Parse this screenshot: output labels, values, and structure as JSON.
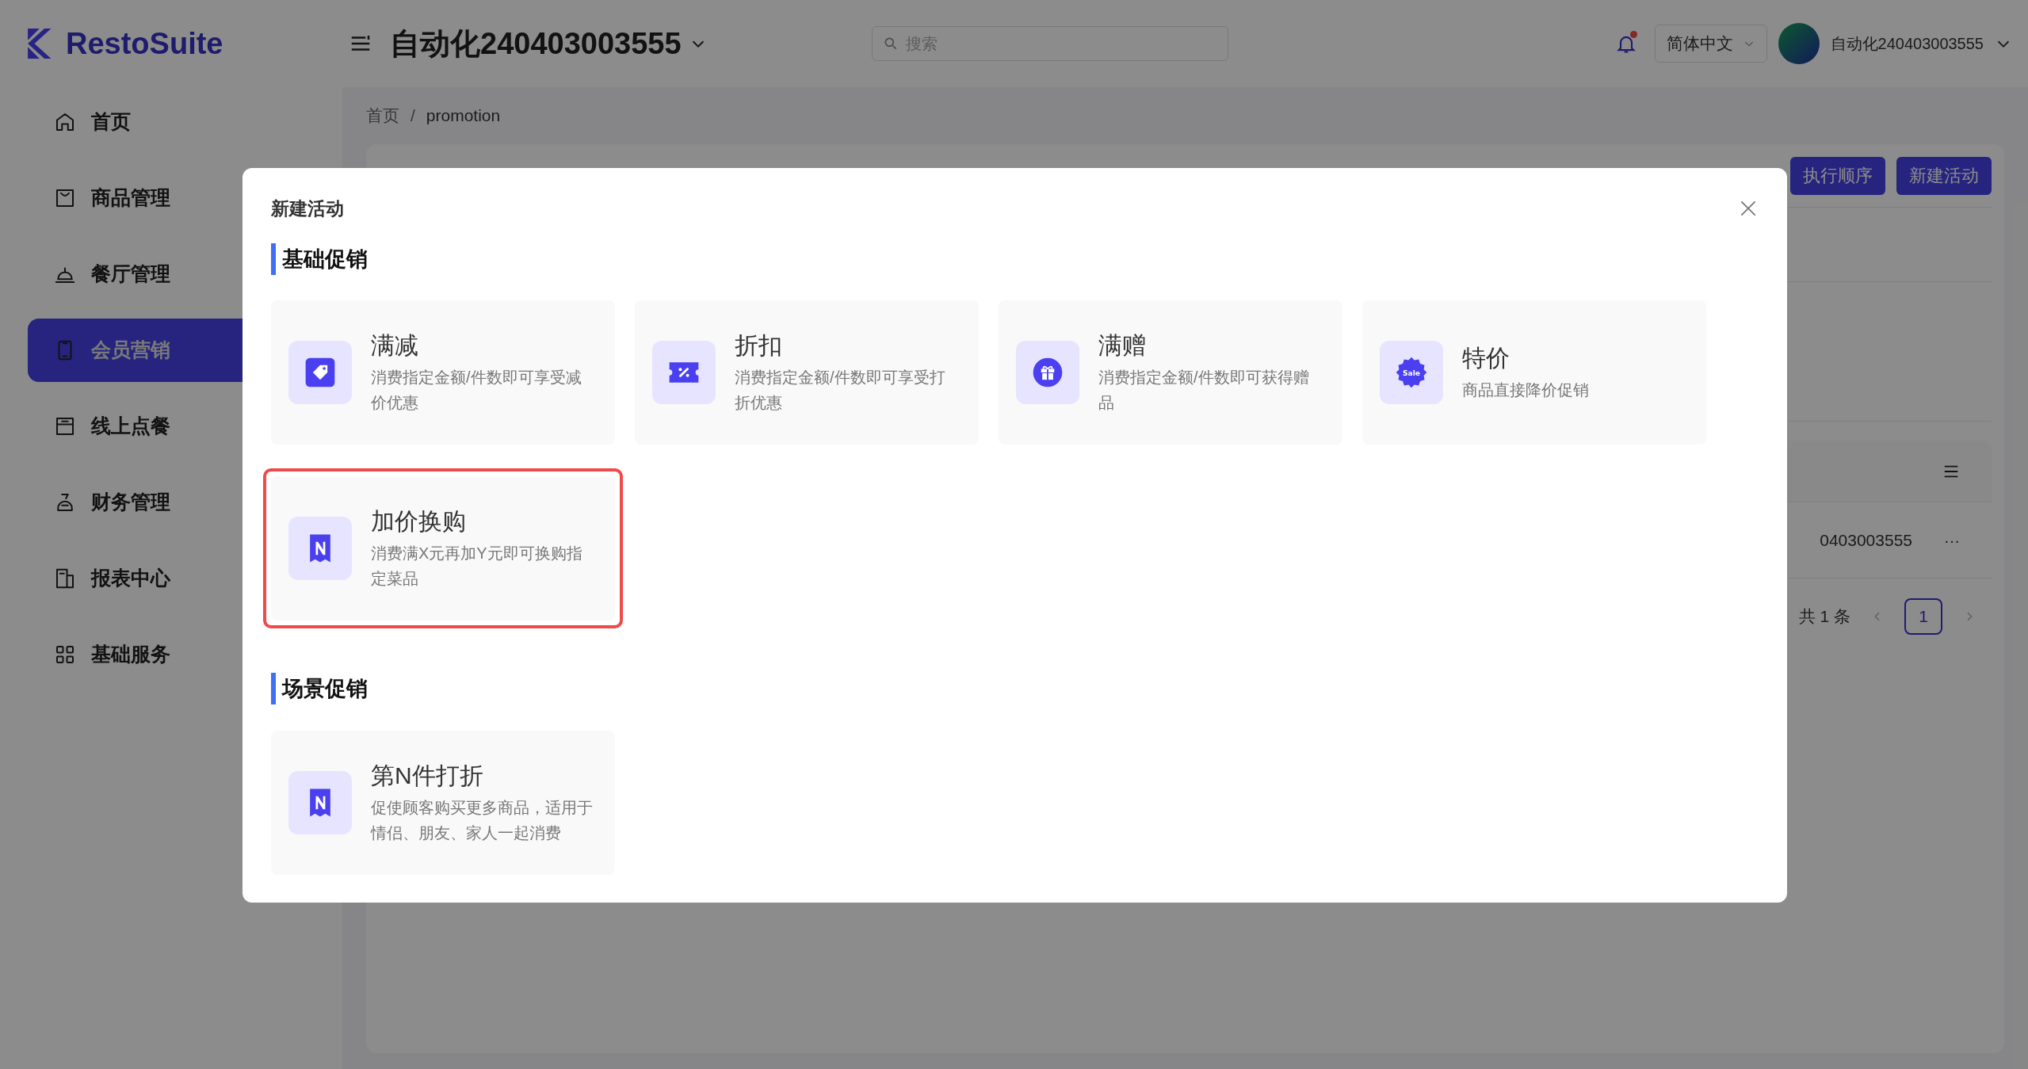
{
  "header": {
    "logo": "RestoSuite",
    "store": "自动化240403003555",
    "search": {
      "placeholder": "搜索"
    },
    "notification": {
      "unread": true
    },
    "language": "简体中文",
    "user": "自动化240403003555"
  },
  "sidebar": {
    "items": [
      {
        "label": "首页",
        "selected": false
      },
      {
        "label": "商品管理",
        "selected": false
      },
      {
        "label": "餐厅管理",
        "selected": false
      },
      {
        "label": "会员营销",
        "selected": true
      },
      {
        "label": "线上点餐",
        "selected": false
      },
      {
        "label": "财务管理",
        "selected": false
      },
      {
        "label": "报表中心",
        "selected": false
      },
      {
        "label": "基础服务",
        "selected": false
      }
    ]
  },
  "breadcrumb": {
    "items": [
      "首页",
      "promotion"
    ],
    "separator": "/"
  },
  "toolbar_buttons": [
    "执行顺序",
    "新建活动"
  ],
  "table": {
    "rows": [
      {
        "column_1": "0403003555",
        "actions": "···"
      }
    ]
  },
  "pagination": {
    "total": "共 1 条",
    "pages": [
      {
        "label": "1",
        "selected": true
      }
    ]
  },
  "modal": {
    "title": "新建活动",
    "sections": [
      {
        "title": "基础促销",
        "cards": [
          {
            "title": "满减",
            "description": "消费指定金额/件数即可享受减价优惠",
            "highlighted": false
          },
          {
            "title": "折扣",
            "description": "消费指定金额/件数即可享受打折优惠",
            "highlighted": false
          },
          {
            "title": "满赠",
            "description": "消费指定金额/件数即可获得赠品",
            "highlighted": false
          },
          {
            "title": "特价",
            "description": "商品直接降价促销",
            "icon_text": "Sale",
            "highlighted": false
          },
          {
            "title": "加价换购",
            "description": "消费满X元再加Y元即可换购指定菜品",
            "highlighted": true
          }
        ]
      },
      {
        "title": "场景促销",
        "cards": [
          {
            "title": "第N件打折",
            "description": "促使顾客购买更多商品，适用于情侣、朋友、家人一起消费",
            "highlighted": false
          }
        ]
      }
    ]
  }
}
